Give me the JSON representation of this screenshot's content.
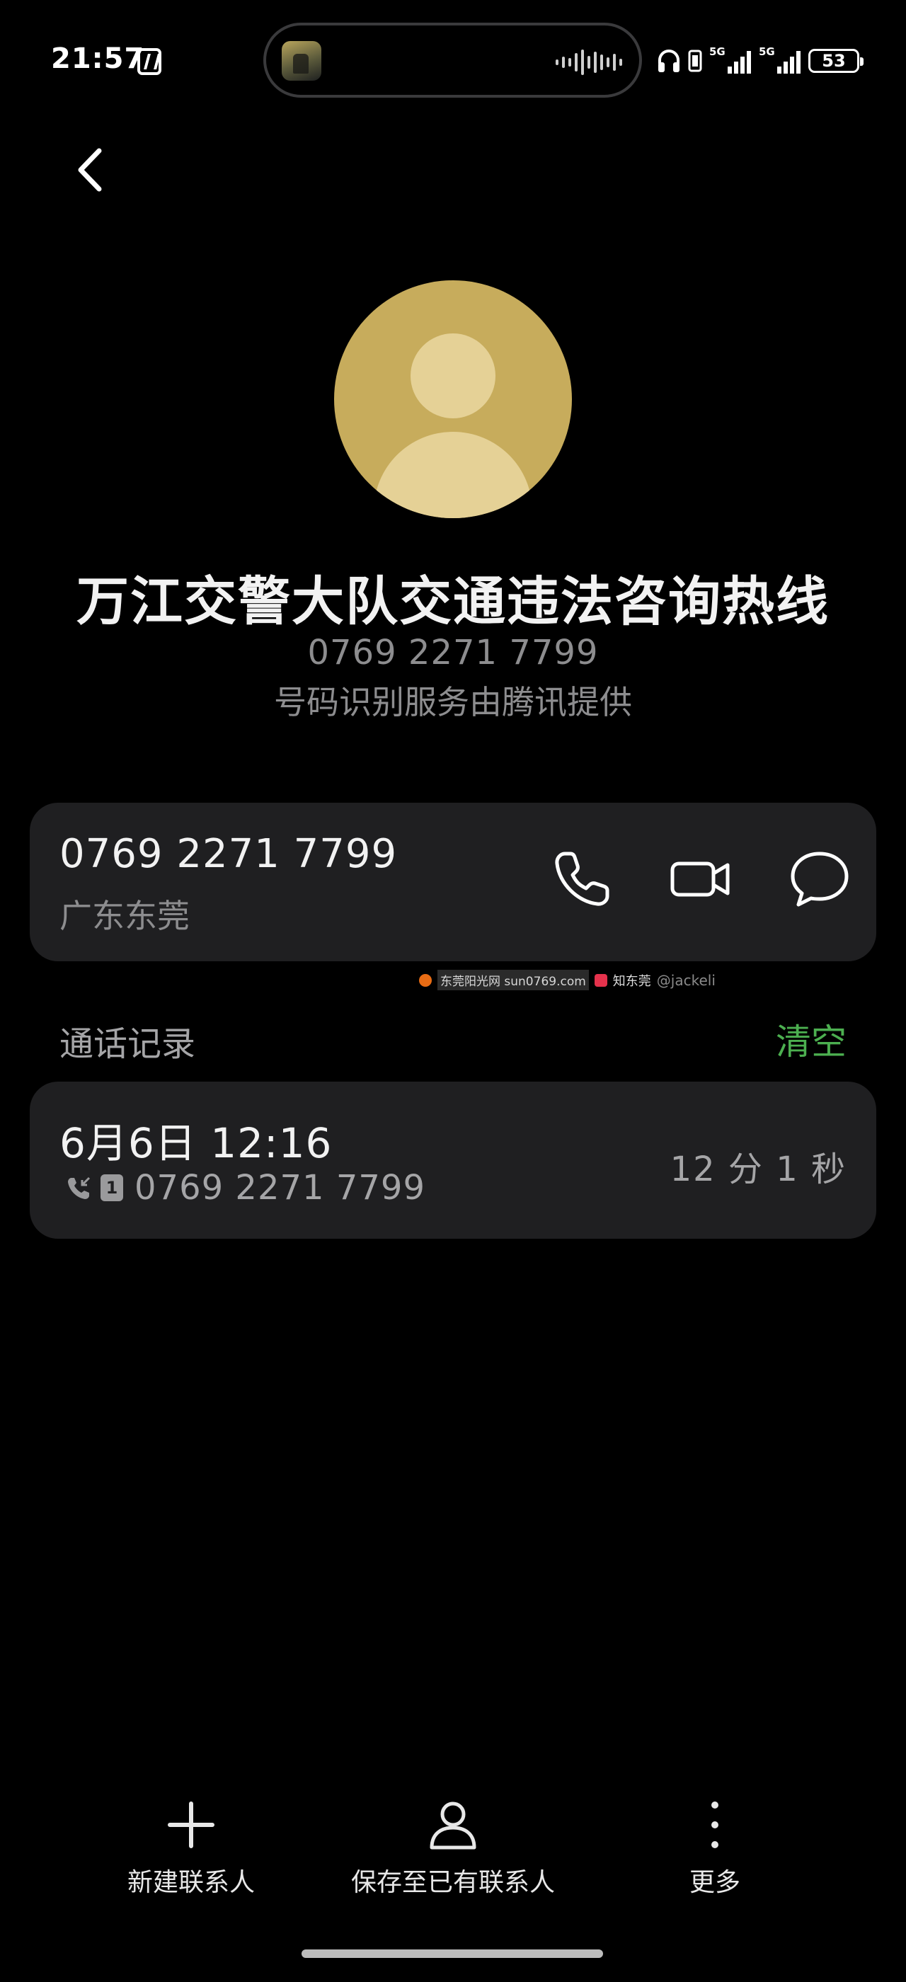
{
  "status_bar": {
    "time": "21:57",
    "signal1_label": "5G",
    "signal2_label": "5G",
    "battery_level": "53"
  },
  "contact": {
    "name": "万江交警大队交通违法咨询热线",
    "number": "0769 2271 7799",
    "provider_note": "号码识别服务由腾讯提供"
  },
  "number_card": {
    "number": "0769 2271 7799",
    "region": "广东东莞"
  },
  "watermark": {
    "site": "东莞阳光网 sun0769.com",
    "brand": "知东莞",
    "handle": "@jackeli"
  },
  "call_log": {
    "title": "通话记录",
    "clear_label": "清空",
    "entries": [
      {
        "date": "6月6日 12:16",
        "sim": "1",
        "number": "0769 2271 7799",
        "duration": "12 分 1 秒"
      }
    ]
  },
  "toolbar": {
    "new_contact": "新建联系人",
    "save_existing": "保存至已有联系人",
    "more": "更多"
  },
  "colors": {
    "background": "#000000",
    "card": "#1f1f21",
    "accent_green": "#4caf50",
    "avatar": "#c7ac5c"
  }
}
